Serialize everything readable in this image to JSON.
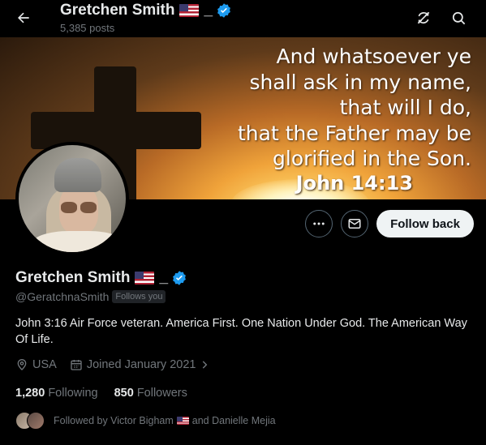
{
  "header": {
    "name": "Gretchen Smith",
    "name_suffix": "_",
    "post_count": "5,385 posts"
  },
  "banner": {
    "verse_lines": [
      "And whatsoever ye",
      "shall ask in my name,",
      "that will I do,",
      "that the Father may be",
      "glorified in the Son."
    ],
    "reference": "John 14:13"
  },
  "actions": {
    "follow_back_label": "Follow back"
  },
  "profile": {
    "name": "Gretchen Smith",
    "name_suffix": "_",
    "handle": "@GeratchnaSmith",
    "follows_you_badge": "Follows you",
    "bio": "John 3:16 Air Force veteran. America First. One Nation Under God. The American Way Of Life.",
    "location": "USA",
    "joined": "Joined January 2021",
    "following_count": "1,280",
    "following_label": "Following",
    "followers_count": "850",
    "followers_label": "Followers",
    "followed_by_prefix": "Followed by Victor Bigham",
    "followed_by_suffix": "and Danielle Mejia"
  },
  "colors": {
    "background": "#000000",
    "primary_text": "#e7e9ea",
    "secondary_text": "#71767b",
    "verified_blue": "#1d9bf0",
    "button_bg": "#eff3f4"
  },
  "icons": [
    "back-arrow-icon",
    "refresh-off-icon",
    "search-icon",
    "more-icon",
    "mail-icon",
    "verified-badge-icon",
    "location-icon",
    "calendar-icon",
    "chevron-right-icon",
    "us-flag-icon"
  ]
}
